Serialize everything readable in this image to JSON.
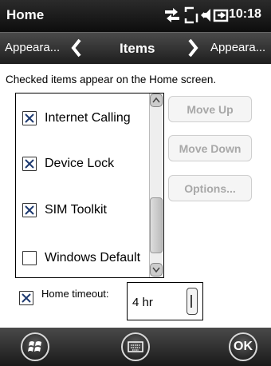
{
  "statusbar": {
    "title": "Home",
    "time": "10:18",
    "icons": [
      "connectivity-icon",
      "sync-icon",
      "volume-icon",
      "battery-charging-icon"
    ]
  },
  "navbar": {
    "left": "Appeara...",
    "center": "Items",
    "right": "Appeara..."
  },
  "instruction": "Checked items appear on the Home screen.",
  "items": [
    {
      "label": "Internet Calling",
      "checked": true
    },
    {
      "label": "Device Lock",
      "checked": true
    },
    {
      "label": "SIM Toolkit",
      "checked": true
    },
    {
      "label": "Windows Default",
      "checked": false
    }
  ],
  "buttons": {
    "move_up": "Move Up",
    "move_down": "Move Down",
    "options": "Options..."
  },
  "timeout": {
    "label": "Home timeout:",
    "checked": true,
    "value": "4 hr"
  },
  "bottombar": {
    "ok": "OK"
  },
  "colors": {
    "disabled_text": "#a8a8a8",
    "bar_dark": "#1a1a1a"
  }
}
